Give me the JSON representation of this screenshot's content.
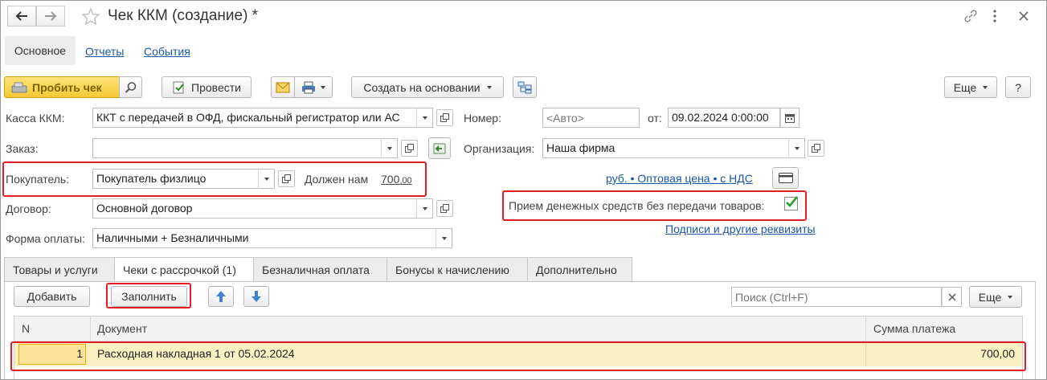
{
  "window": {
    "title": "Чек ККМ (создание) *"
  },
  "nav_tabs": [
    {
      "label": "Основное"
    },
    {
      "label": "Отчеты"
    },
    {
      "label": "События"
    }
  ],
  "toolbar": {
    "print_receipt": "Пробить чек",
    "post": "Провести",
    "create_based": "Создать на основании",
    "more": "Еще",
    "help": "?"
  },
  "form": {
    "cash_register_label": "Касса ККМ:",
    "cash_register_value": "ККТ с передачей в ОФД, фискальный регистратор или АС",
    "number_label": "Номер:",
    "number_placeholder": "<Авто>",
    "date_from_label": "от:",
    "date_value": "09.02.2024  0:00:00",
    "order_label": "Заказ:",
    "order_value": "",
    "organization_label": "Организация:",
    "organization_value": "Наша фирма",
    "buyer_label": "Покупатель:",
    "buyer_value": "Покупатель физлицо",
    "owes_label": "Должен нам",
    "owes_amount": "700",
    "owes_cents": ",00",
    "price_link": "руб. • Оптовая цена • с НДС",
    "contract_label": "Договор:",
    "contract_value": "Основной договор",
    "receipt_checkbox_label": "Прием денежных средств без передачи товаров:",
    "receipt_checked": true,
    "payment_form_label": "Форма оплаты:",
    "payment_form_value": "Наличными + Безналичными",
    "signatures_link": "Подписи и другие реквизиты"
  },
  "tabs": [
    {
      "label": "Товары и услуги",
      "active": false
    },
    {
      "label": "Чеки с рассрочкой (1)",
      "active": true
    },
    {
      "label": "Безналичная оплата",
      "active": false
    },
    {
      "label": "Бонусы к начислению",
      "active": false
    },
    {
      "label": "Дополнительно",
      "active": false
    }
  ],
  "table_toolbar": {
    "add": "Добавить",
    "fill": "Заполнить",
    "search_placeholder": "Поиск (Ctrl+F)",
    "more": "Еще"
  },
  "table": {
    "columns": [
      "N",
      "Документ",
      "Сумма платежа"
    ],
    "rows": [
      {
        "n": "1",
        "document": "Расходная накладная 1 от 05.02.2024",
        "amount": "700,00"
      }
    ]
  },
  "colors": {
    "highlight_red": "#e51c23",
    "selected_row": "#fbf0c2",
    "link": "#1a56a8",
    "check_green": "#2aa02a"
  }
}
